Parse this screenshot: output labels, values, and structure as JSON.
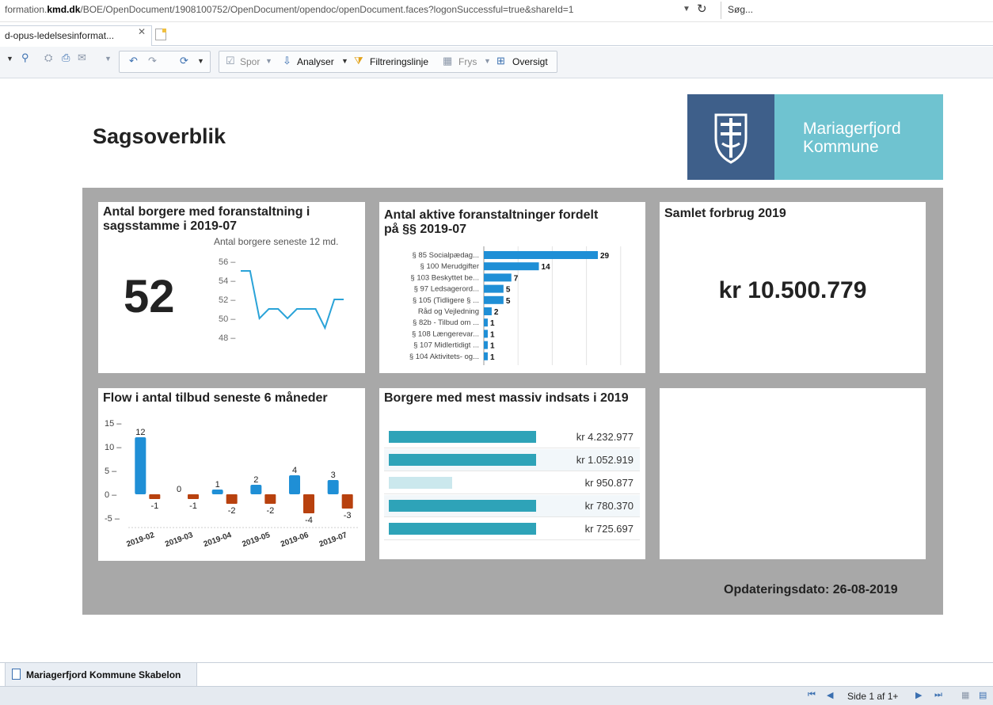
{
  "browser": {
    "url_prefix": "formation.",
    "url_domain": "kmd.dk",
    "url_path": "/BOE/OpenDocument/1908100752/OpenDocument/opendoc/openDocument.faces?logonSuccessful=true&shareId=1",
    "search_placeholder": "Søg...",
    "tab_title": "d-opus-ledelsesinformat..."
  },
  "toolbar": {
    "spor": "Spor",
    "analyser": "Analyser",
    "filter": "Filtreringslinje",
    "frys": "Frys",
    "oversigt": "Oversigt"
  },
  "report": {
    "title": "Sagsoverblik",
    "logo": {
      "line1": "Mariagerfjord",
      "line2": "Kommune"
    },
    "update_date": "Opdateringsdato: 26-08-2019"
  },
  "kpi_citizens": {
    "title_line1": "Antal borgere med foranstaltning i",
    "title_line2": "sagsstamme i 2019-07",
    "value": "52",
    "spark_title": "Antal borgere seneste 12 md."
  },
  "active_measures": {
    "title_line1": "Antal aktive foranstaltninger fordelt",
    "title_line2": "på §§ 2019-07"
  },
  "total_spend": {
    "title": "Samlet forbrug 2019",
    "value": "kr 10.500.779"
  },
  "flow": {
    "title": "Flow i antal tilbud seneste 6 måneder"
  },
  "top_citizens": {
    "title": "Borgere med mest massiv indsats i 2019",
    "values": [
      "kr 4.232.977",
      "kr 1.052.919",
      "kr 950.877",
      "kr 780.370",
      "kr 725.697"
    ]
  },
  "colors": {
    "bar_blue": "#1f8fd6",
    "bar_orange": "#b8410e",
    "line_blue": "#2aa3d8",
    "cost_bar": "#2ea3b8",
    "logo_dark": "#3e5f8a",
    "logo_light": "#6fc3d0"
  },
  "chart_data": [
    {
      "type": "line",
      "title": "Antal borgere seneste 12 md.",
      "x": [
        "1",
        "2",
        "3",
        "4",
        "5",
        "6",
        "7",
        "8",
        "9",
        "10",
        "11",
        "12"
      ],
      "values": [
        55,
        55,
        50,
        51,
        51,
        50,
        51,
        51,
        51,
        49,
        52,
        52
      ],
      "yticks": [
        56,
        54,
        52,
        50,
        48
      ],
      "ylim": [
        47,
        57
      ]
    },
    {
      "type": "bar",
      "orientation": "horizontal",
      "categories": [
        "§ 85 Socialpædag...",
        "§ 100 Merudgifter",
        "§ 103 Beskyttet be...",
        "§ 97 Ledsagerord...",
        "§ 105 (Tidligere § ...",
        "Råd og Vejledning",
        "§ 82b - Tilbud om ...",
        "§ 108 Længerevar...",
        "§ 107 Midlertidigt ...",
        "§ 104 Aktivitets- og..."
      ],
      "values": [
        29,
        14,
        7,
        5,
        5,
        2,
        1,
        1,
        1,
        1
      ],
      "labels": [
        "29",
        "14",
        "7",
        "5",
        "5",
        "2",
        "1",
        "1",
        "1",
        "1"
      ]
    },
    {
      "type": "bar",
      "categories": [
        "2019-02",
        "2019-03",
        "2019-04",
        "2019-05",
        "2019-06",
        "2019-07"
      ],
      "series": [
        {
          "values": [
            12,
            0,
            1,
            2,
            4,
            3
          ]
        },
        {
          "values": [
            -1,
            -1,
            -2,
            -2,
            -4,
            -3
          ]
        }
      ],
      "value_labels": [
        [
          "12",
          "0",
          "1",
          "2",
          "4",
          "3"
        ],
        [
          "-1",
          "-1",
          "-2",
          "-2",
          "-4",
          "-3"
        ]
      ],
      "yticks": [
        "15",
        "10",
        "5",
        "0",
        "-5"
      ],
      "ylim": [
        -5,
        15
      ]
    }
  ]
}
